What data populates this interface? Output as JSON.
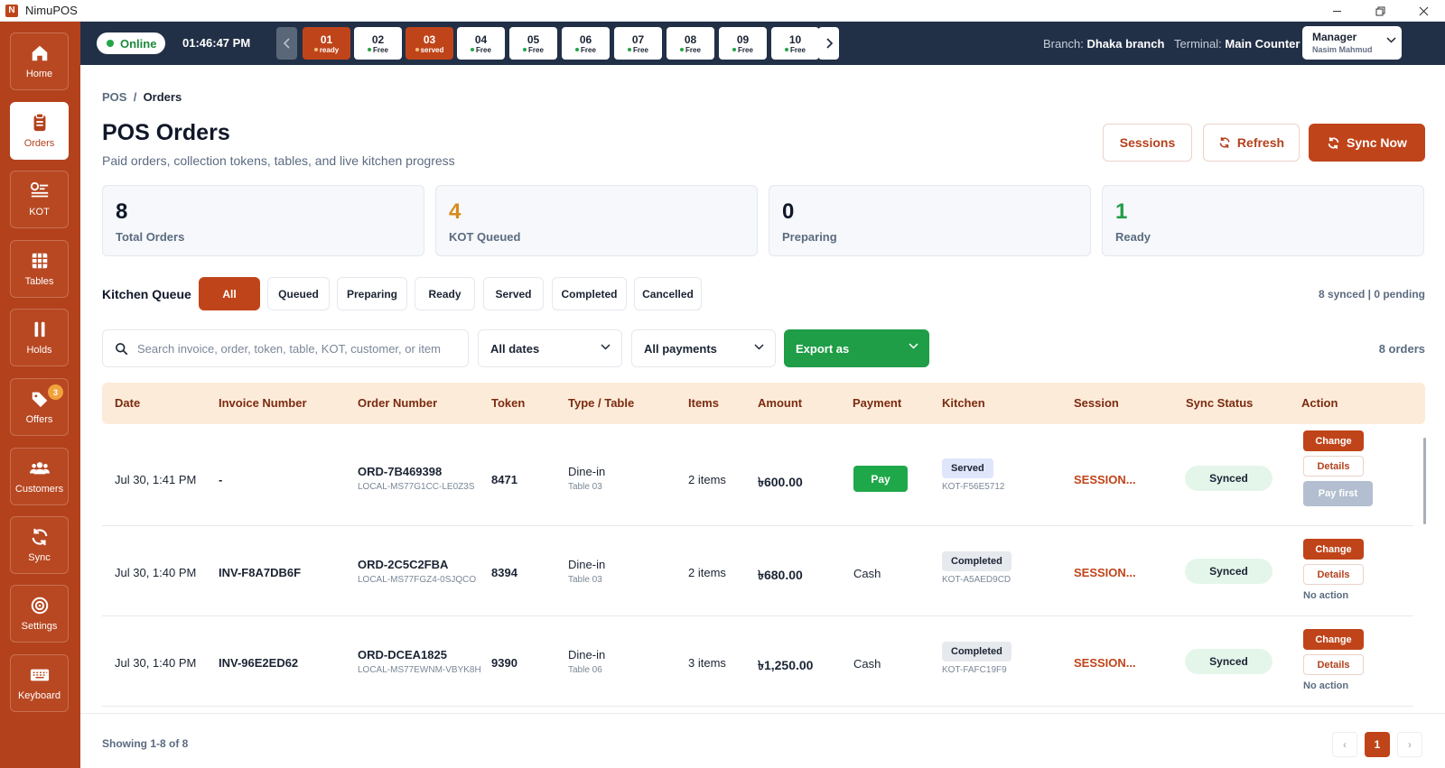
{
  "app": {
    "title": "NimuPOS",
    "logo_letter": "N"
  },
  "window": {
    "minimize_icon": "minimize-icon",
    "restore_icon": "restore-icon",
    "close_icon": "close-icon"
  },
  "sidebar": {
    "items": [
      {
        "label": "Home",
        "icon": "home-icon"
      },
      {
        "label": "Orders",
        "icon": "clipboard-icon",
        "active": true
      },
      {
        "label": "KOT",
        "icon": "kot-icon"
      },
      {
        "label": "Tables",
        "icon": "grid-icon"
      },
      {
        "label": "Holds",
        "icon": "pause-icon"
      },
      {
        "label": "Offers",
        "icon": "tag-icon",
        "badge": "3"
      },
      {
        "label": "Customers",
        "icon": "users-icon"
      },
      {
        "label": "Sync",
        "icon": "sync-icon"
      },
      {
        "label": "Settings",
        "icon": "settings-icon"
      },
      {
        "label": "Keyboard",
        "icon": "keyboard-icon"
      }
    ]
  },
  "topbar": {
    "status": "Online",
    "clock": "01:46:47 PM",
    "tables": [
      {
        "num": "01",
        "status": "ready"
      },
      {
        "num": "02",
        "status": "Free"
      },
      {
        "num": "03",
        "status": "served"
      },
      {
        "num": "04",
        "status": "Free"
      },
      {
        "num": "05",
        "status": "Free"
      },
      {
        "num": "06",
        "status": "Free"
      },
      {
        "num": "07",
        "status": "Free"
      },
      {
        "num": "08",
        "status": "Free"
      },
      {
        "num": "09",
        "status": "Free"
      },
      {
        "num": "10",
        "status": "Free"
      }
    ],
    "branch_label": "Branch:",
    "branch": "Dhaka branch",
    "terminal_label": "Terminal:",
    "terminal": "Main Counter",
    "user_role": "Manager",
    "user_name": "Nasim Mahmud"
  },
  "page": {
    "breadcrumb_root": "POS",
    "breadcrumb_sep": "/",
    "breadcrumb_current": "Orders",
    "title": "POS Orders",
    "subtitle": "Paid orders, collection tokens, tables, and live kitchen progress",
    "buttons": {
      "sessions": "Sessions",
      "refresh": "Refresh",
      "sync_now": "Sync Now"
    }
  },
  "stats": [
    {
      "value": "8",
      "label": "Total Orders",
      "color": "#0f1729"
    },
    {
      "value": "4",
      "label": "KOT Queued",
      "color": "#d98a1a"
    },
    {
      "value": "0",
      "label": "Preparing",
      "color": "#0f1729"
    },
    {
      "value": "1",
      "label": "Ready",
      "color": "#1f9d47"
    }
  ],
  "kitchen_queue": {
    "label": "Kitchen Queue",
    "filters": [
      "All",
      "Queued",
      "Preparing",
      "Ready",
      "Served",
      "Completed",
      "Cancelled"
    ],
    "active": "All",
    "sync_summary": "8 synced | 0 pending"
  },
  "filters": {
    "search_placeholder": "Search invoice, order, token, table, KOT, customer, or item",
    "dates": "All dates",
    "payments": "All payments",
    "export": "Export as",
    "count": "8 orders"
  },
  "table": {
    "columns": [
      "Date",
      "Invoice Number",
      "Order Number",
      "Token",
      "Type / Table",
      "Items",
      "Amount",
      "Payment",
      "Kitchen",
      "Session",
      "Sync Status",
      "Action"
    ],
    "rows": [
      {
        "date": "Jul 30, 1:41 PM",
        "invoice": "-",
        "order": "ORD-7B469398",
        "order_local": "LOCAL-MS77G1CC-LE0Z3S",
        "token": "8471",
        "type": "Dine-in",
        "table": "Table 03",
        "items": "2 items",
        "amount": "৳600.00",
        "payment": "Pay",
        "kitchen": "Served",
        "kot": "KOT-F56E5712",
        "session": "SESSION...",
        "sync": "Synced",
        "actions": [
          "Change",
          "Details",
          "Pay first"
        ]
      },
      {
        "date": "Jul 30, 1:40 PM",
        "invoice": "INV-F8A7DB6F",
        "order": "ORD-2C5C2FBA",
        "order_local": "LOCAL-MS77FGZ4-0SJQCO",
        "token": "8394",
        "type": "Dine-in",
        "table": "Table 03",
        "items": "2 items",
        "amount": "৳680.00",
        "payment": "Cash",
        "kitchen": "Completed",
        "kot": "KOT-A5AED9CD",
        "session": "SESSION...",
        "sync": "Synced",
        "actions": [
          "Change",
          "Details",
          "No action"
        ]
      },
      {
        "date": "Jul 30, 1:40 PM",
        "invoice": "INV-96E2ED62",
        "order": "ORD-DCEA1825",
        "order_local": "LOCAL-MS77EWNM-VBYK8H",
        "token": "9390",
        "type": "Dine-in",
        "table": "Table 06",
        "items": "3 items",
        "amount": "৳1,250.00",
        "payment": "Cash",
        "kitchen": "Completed",
        "kot": "KOT-FAFC19F9",
        "session": "SESSION...",
        "sync": "Synced",
        "actions": [
          "Change",
          "Details",
          "No action"
        ]
      }
    ]
  },
  "pagination": {
    "showing": "Showing 1-8 of 8",
    "current": "1",
    "prev": "‹",
    "next": "›"
  }
}
